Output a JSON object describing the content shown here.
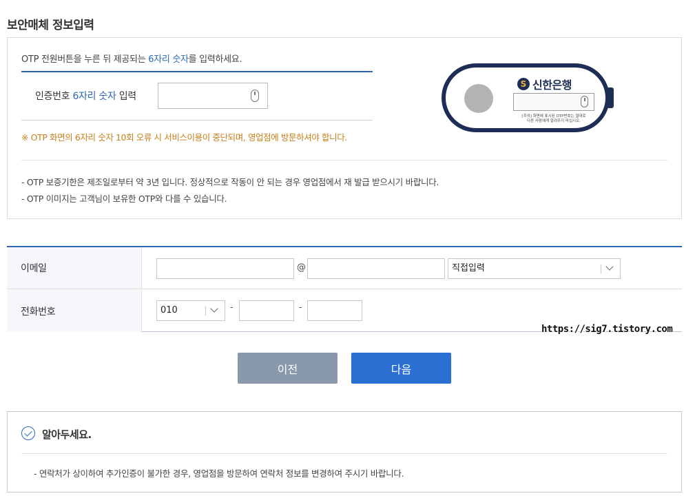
{
  "page": {
    "title": "보안매체 정보입력"
  },
  "otp": {
    "instruction": {
      "before": "OTP 전원버튼을 누른 뒤 제공되는 ",
      "highlight": "6자리 숫자",
      "after": "를 입력하세요."
    },
    "code_label": {
      "before": "인증번호 ",
      "highlight": "6자리 숫자",
      "after": " 입력"
    },
    "code_value": "",
    "warning": "※ OTP 화면의 6자리 숫자 10회 오류 시 서비스이용이 중단되며, 영업점에 방문하셔야 합니다.",
    "notes": [
      "-  OTP 보증기한은 제조일로부터 약 3년 입니다. 정상적으로 작동이 안 되는 경우 영업점에서 재 발급 받으시기 바랍니다.",
      "-  OTP 이미지는 고객님이 보유한 OTP와 다를 수 있습니다."
    ],
    "token": {
      "bank_name": "신한은행",
      "logo_letter": "S",
      "caption_line1": "[주의] 화면에 표시된 OTP번호는 절대로",
      "caption_line2": "다른 사람에게 알려주지 마십시오.",
      "body_color": "#1e2d55",
      "logo_accent_color": "#e8b43a"
    }
  },
  "form": {
    "email": {
      "label": "이메일",
      "local_value": "",
      "at": "@",
      "domain_value": "",
      "domain_select": "직접입력"
    },
    "phone": {
      "label": "전화번호",
      "prefix": "010",
      "dash": "-",
      "middle_value": "",
      "last_value": ""
    }
  },
  "buttons": {
    "prev": "이전",
    "next": "다음"
  },
  "notice": {
    "title": "알아두세요.",
    "text": "-  연락처가 상이하여 추가인증이 불가한 경우, 영업점을 방문하여 연락처 정보를 변경하여 주시기 바랍니다."
  },
  "watermark": "https://sig7.tistory.com",
  "colors": {
    "accent": "#2b66b7",
    "warning": "#c77e19",
    "prev_button": "#8998ad",
    "next_button": "#2a6fd1"
  }
}
